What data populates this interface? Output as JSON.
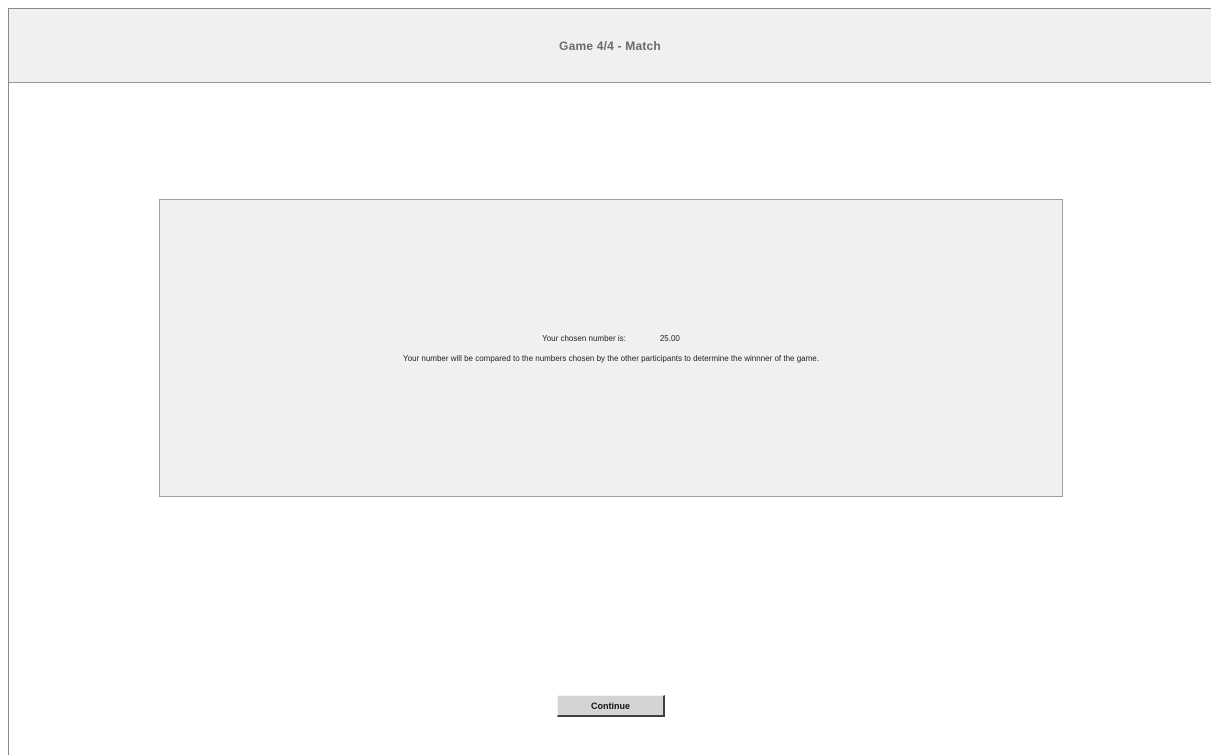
{
  "header": {
    "title": "Game 4/4 - Match"
  },
  "panel": {
    "chosen_label": "Your chosen number is:",
    "chosen_value": "25.00",
    "info": "Your number will be compared to the numbers chosen by the other participants to determine the winnner of the game."
  },
  "actions": {
    "continue_label": "Continue"
  }
}
